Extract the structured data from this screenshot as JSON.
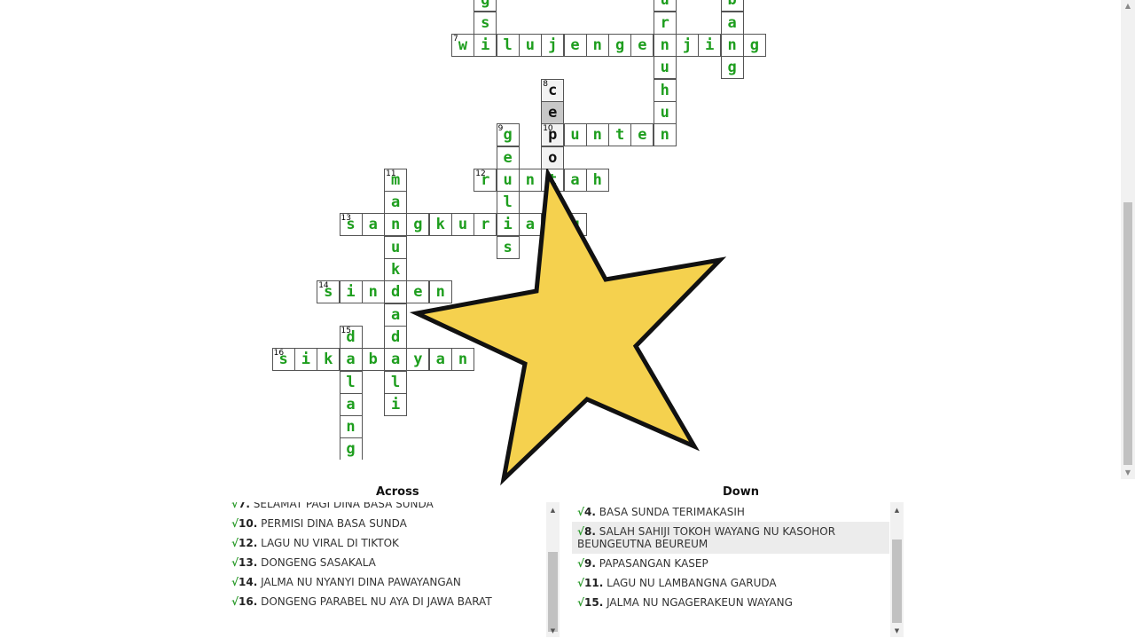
{
  "puzzle": {
    "words": [
      {
        "num": "",
        "dir": "down",
        "col": 21,
        "row": -2,
        "text": "gs",
        "start": 0
      },
      {
        "num": "",
        "dir": "down",
        "col": 29,
        "row": -2,
        "text": "urnuhu",
        "start": 0
      },
      {
        "num": "",
        "dir": "down",
        "col": 32,
        "row": -2,
        "text": "bang",
        "start": 0
      },
      {
        "num": "7",
        "dir": "across",
        "col": 20,
        "row": 0,
        "text": "wilujengenjing"
      },
      {
        "num": "8",
        "dir": "down",
        "col": 24,
        "row": 2,
        "text": "cepo"
      },
      {
        "num": "9",
        "dir": "down",
        "col": 22,
        "row": 4,
        "text": "geulis"
      },
      {
        "num": "10",
        "dir": "across",
        "col": 24,
        "row": 4,
        "text": "punten"
      },
      {
        "num": "11",
        "dir": "down",
        "col": 17,
        "row": 6,
        "text": "manukdadali"
      },
      {
        "num": "12",
        "dir": "across",
        "col": 21,
        "row": 6,
        "text": "runtah"
      },
      {
        "num": "13",
        "dir": "across",
        "col": 15,
        "row": 8,
        "text": "sangkuriang"
      },
      {
        "num": "14",
        "dir": "across",
        "col": 14,
        "row": 11,
        "text": "sinden"
      },
      {
        "num": "15",
        "dir": "down",
        "col": 15,
        "row": 13,
        "text": "dalang"
      },
      {
        "num": "16",
        "dir": "across",
        "col": 12,
        "row": 14,
        "text": "sikabayan"
      }
    ],
    "active_word": "8",
    "active_cell": "8-1"
  },
  "across": {
    "title": "Across",
    "clues": [
      {
        "tick": "√",
        "num": "7.",
        "text": "SELAMAT PAGI DINA BASA SUNDA"
      },
      {
        "tick": "√",
        "num": "10.",
        "text": "PERMISI DINA BASA SUNDA"
      },
      {
        "tick": "√",
        "num": "12.",
        "text": "LAGU NU VIRAL DI TIKTOK"
      },
      {
        "tick": "√",
        "num": "13.",
        "text": "DONGENG SASAKALA"
      },
      {
        "tick": "√",
        "num": "14.",
        "text": "JALMA NU NYANYI DINA PAWAYANGAN"
      },
      {
        "tick": "√",
        "num": "16.",
        "text": "DONGENG PARABEL NU AYA DI JAWA BARAT"
      }
    ]
  },
  "down": {
    "title": "Down",
    "clues": [
      {
        "tick": "√",
        "num": "4.",
        "text": "BASA SUNDA TERIMAKASIH"
      },
      {
        "tick": "√",
        "num": "8.",
        "text": "SALAH SAHIJI TOKOH WAYANG NU KASOHOR BEUNGEUTNA BEUREUM"
      },
      {
        "tick": "√",
        "num": "9.",
        "text": "PAPASANGAN KASEP"
      },
      {
        "tick": "√",
        "num": "11.",
        "text": "LAGU NU LAMBANGNA GARUDA"
      },
      {
        "tick": "√",
        "num": "15.",
        "text": "JALMA NU NGAGERAKEUN WAYANG"
      }
    ]
  },
  "colors": {
    "filled": "#1e9e1e",
    "check": "#2a9a2a",
    "star_fill": "#f5d14e",
    "star_stroke": "#111111"
  },
  "icons": {
    "star": "star-icon",
    "scroll_up": "triangle-up-icon",
    "scroll_down": "triangle-down-icon"
  }
}
